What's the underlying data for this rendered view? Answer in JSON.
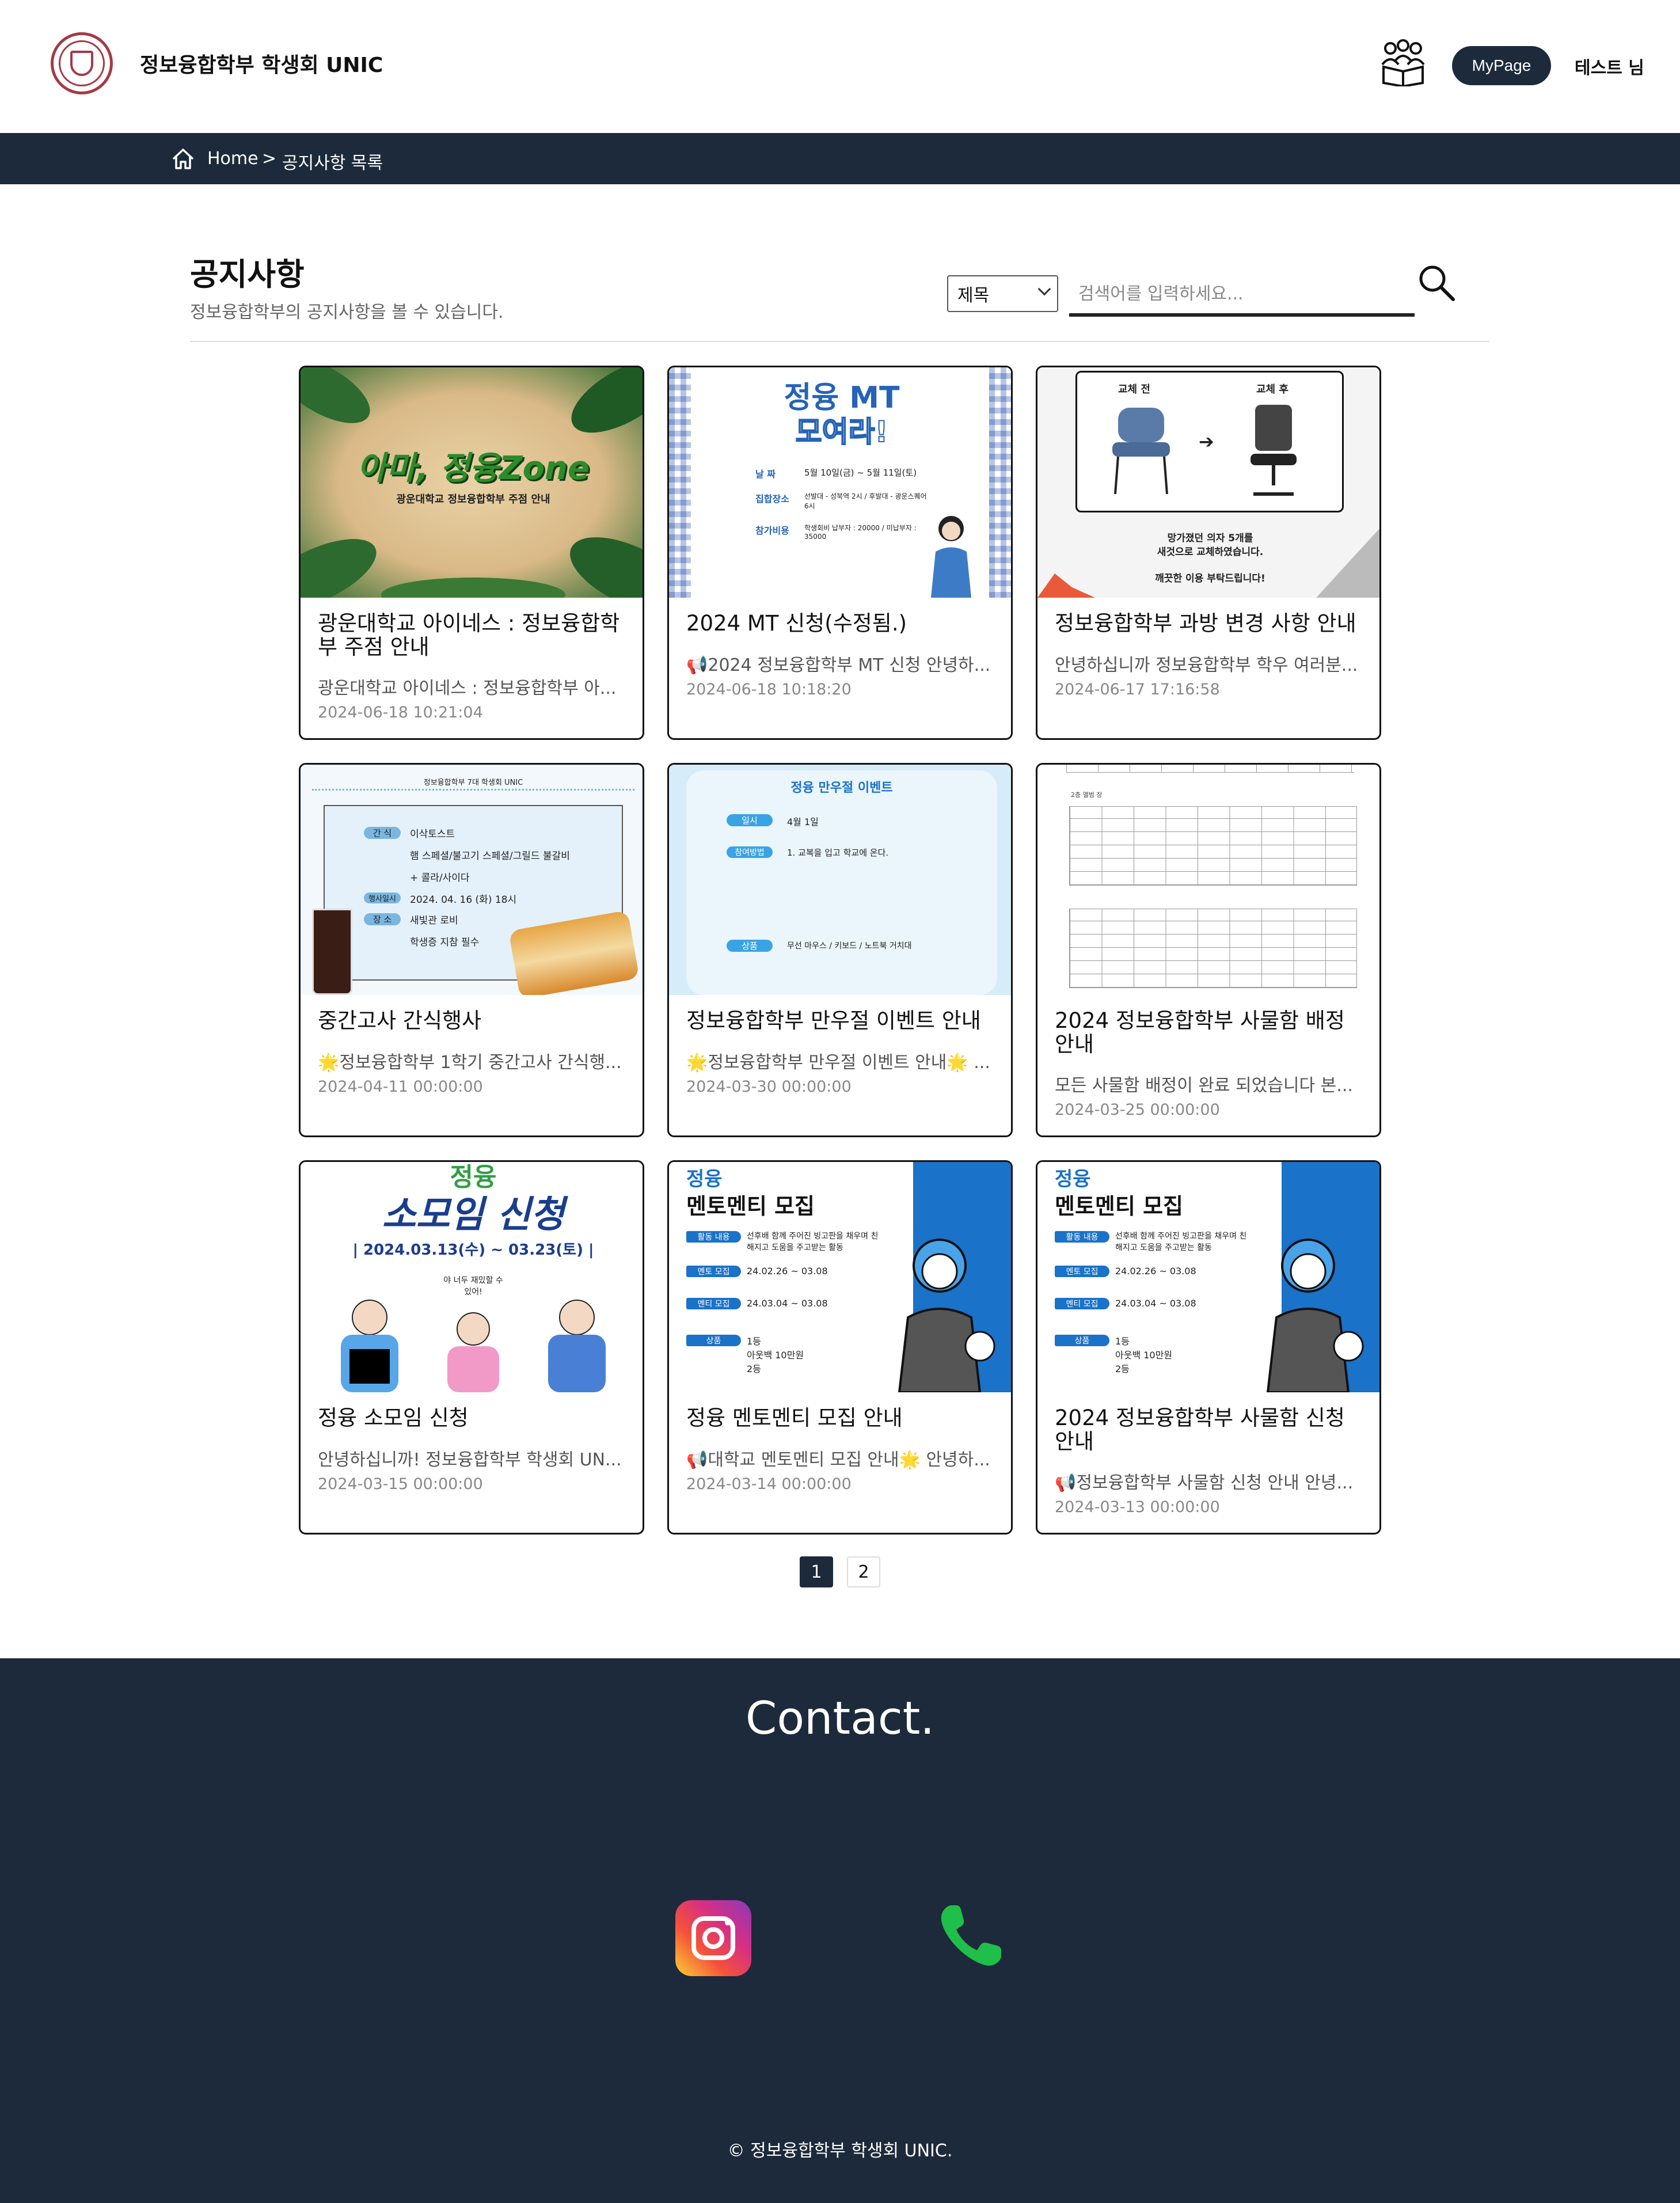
{
  "header": {
    "brand": "정보융합학부 학생회 UNIC",
    "mypage_label": "MyPage",
    "user_label": "테스트 님"
  },
  "breadcrumb": {
    "home": "Home",
    "separator": ">",
    "current": "공지사항 목록"
  },
  "main": {
    "title": "공지사항",
    "subtitle": "정보융합학부의 공지사항을 볼 수 있습니다.",
    "search": {
      "select_value": "제목",
      "placeholder": "검색어를 입력하세요..."
    }
  },
  "thumbs": {
    "t1": {
      "title": "아마, 정융Zone",
      "sub": "광운대학교 정보융합학부 주점 안내"
    },
    "t2": {
      "title": "정융 MT",
      "title2": "모여라!",
      "l1": "날   짜",
      "v1": "5월 10일(금) ~ 5월 11일(토)",
      "l2": "집합장소",
      "v2": "선발대 - 성북역 2시 / 후발대 - 광운스퀘어 6시",
      "l3": "참가비용",
      "v3": "학생회비 납부자 : 20000 / 미납부자 : 35000"
    },
    "t3": {
      "before": "교체 전",
      "after": "교체 후",
      "l1": "망가졌던 의자 5개를",
      "l2": "새것으로 교체하였습니다.",
      "l3": "깨끗한 이용 부탁드립니다!"
    },
    "t4": {
      "head": "정보융합학부 7대 학생회 UNIC",
      "k1": "간 식",
      "v1": "이삭토스트",
      "v1b": "햄 스페셜/불고기 스페셜/그릴드 불갈비",
      "v1c": "+ 콜라/사이다",
      "k2": "행사일시",
      "v2": "2024. 04. 16 (화) 18시",
      "k3": "장 소",
      "v3": "새빛관 로비",
      "v3b": "학생증 지참 필수"
    },
    "t5": {
      "head": "정융 만우절 이벤트",
      "k1": "일시",
      "v1": "4월 1일",
      "k2": "참여방법",
      "v2": "1. 교복을 입고 학교에 온다.",
      "k3": "상품",
      "v3": "무선 마우스 / 키보드 / 노트북 거치대"
    },
    "t6": {
      "label": "2층 앨범 장"
    },
    "t7": {
      "top": "정융",
      "title": "소모임 신청",
      "date": "| 2024.03.13(수) ~ 03.23(토) |",
      "bubble": "야 너두 재밌할 수 있어!"
    },
    "t8": {
      "top": "정융",
      "title": "멘토멘티 모집",
      "k1": "활동 내용",
      "v1": "선후배 함께 주어진 빙고판을 채우며 친해지고 도움을 주고받는 활동",
      "k2": "멘토 모집",
      "v2": "24.02.26 ~ 03.08",
      "k3": "멘티 모집",
      "v3": "24.03.04 ~ 03.08",
      "k4": "상품",
      "v4": "1등",
      "v4b": "아웃백 10만원",
      "v4c": "2등"
    }
  },
  "cards": [
    {
      "title": "광운대학교 아이네스 : 정보융합학부 주점 안내",
      "excerpt": "광운대학교 아이네스 : 정보융합학부 아...",
      "date": "2024-06-18 10:21:04"
    },
    {
      "title": "2024 MT 신청(수정됨.)",
      "excerpt": "📢2024 정보융합학부 MT 신청 안녕하...",
      "date": "2024-06-18 10:18:20"
    },
    {
      "title": "정보융합학부 과방 변경 사항 안내",
      "excerpt": "안녕하십니까 정보융합학부 학우 여러분...",
      "date": "2024-06-17 17:16:58"
    },
    {
      "title": "중간고사 간식행사",
      "excerpt": "🌟정보융합학부 1학기 중간고사 간식행...",
      "date": "2024-04-11 00:00:00"
    },
    {
      "title": "정보융합학부 만우절 이벤트 안내",
      "excerpt": "🌟정보융합학부 만우절 이벤트 안내🌟 ...",
      "date": "2024-03-30 00:00:00"
    },
    {
      "title": "2024 정보융합학부 사물함 배정 안내",
      "excerpt": "모든 사물함 배정이 완료 되었습니다 본...",
      "date": "2024-03-25 00:00:00"
    },
    {
      "title": "정융 소모임 신청",
      "excerpt": "안녕하십니까! 정보융합학부 학생회 UN...",
      "date": "2024-03-15 00:00:00"
    },
    {
      "title": "정융 멘토멘티 모집 안내",
      "excerpt": "📢대학교 멘토멘티 모집 안내🌟 안녕하...",
      "date": "2024-03-14 00:00:00"
    },
    {
      "title": "2024 정보융합학부 사물함 신청 안내",
      "excerpt": "📢정보융합학부 사물함 신청 안내 안녕...",
      "date": "2024-03-13 00:00:00"
    }
  ],
  "pagination": {
    "pages": [
      "1",
      "2"
    ],
    "current": "1"
  },
  "footer": {
    "contact_title": "Contact.",
    "copyright": "© 정보융합학부 학생회 UNIC."
  },
  "icons": {
    "people": "people-book-icon",
    "home": "home-icon",
    "search": "search-icon",
    "instagram": "instagram-icon",
    "phone": "phone-icon"
  },
  "colors": {
    "navy": "#1d2a3b",
    "accent_blue": "#1a72c9",
    "instagram_gradient": [
      "#fbd133",
      "#f5513a",
      "#d62f84",
      "#8a3ab9"
    ],
    "phone_green": "#1fbf4a"
  }
}
